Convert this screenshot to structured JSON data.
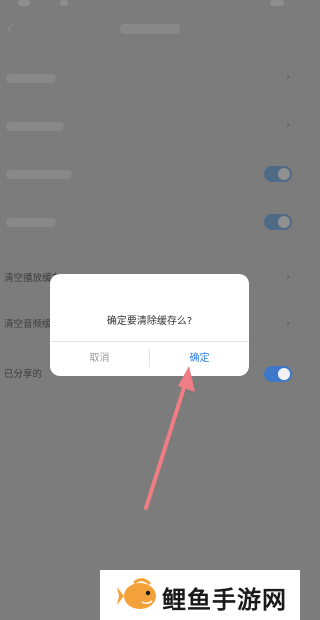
{
  "settings": {
    "rows": [
      {
        "label": "清空播放缓存",
        "control": "chevron"
      },
      {
        "label": "清空音频缓存",
        "control": "chevron"
      },
      {
        "label": "已分享的",
        "control": "toggle"
      }
    ]
  },
  "dialog": {
    "message": "确定要清除缓存么?",
    "cancel_label": "取消",
    "confirm_label": "确定"
  },
  "watermark": {
    "text": "鲤鱼手游网"
  },
  "icons": {
    "chevron": "›",
    "back": "back-icon",
    "arrow": "annotation-arrow"
  },
  "colors": {
    "overlay": "#7c7c7c",
    "toggle_on": "#3f78c8",
    "confirm": "#2f7fe0",
    "arrow": "#f07c84",
    "logo": "#f3a23b"
  }
}
